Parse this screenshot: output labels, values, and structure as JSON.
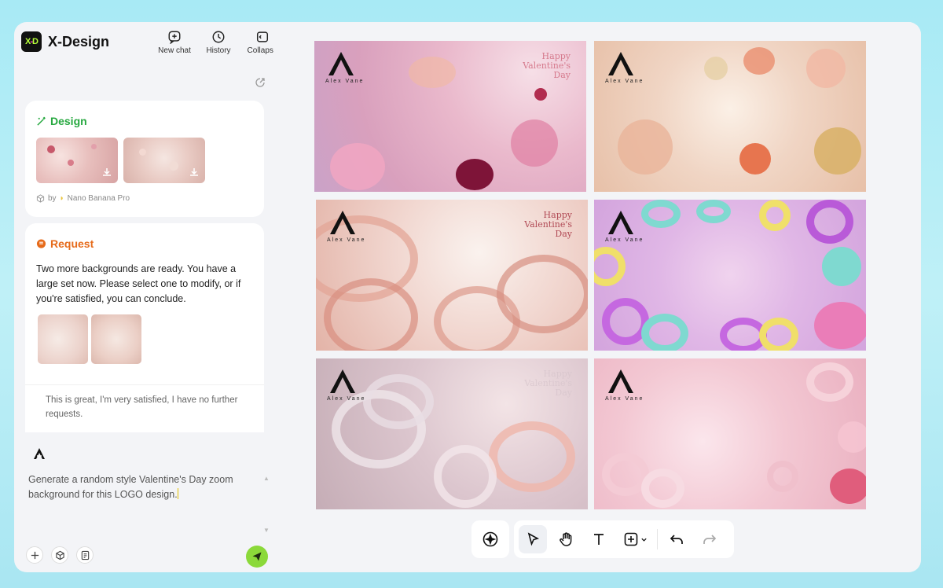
{
  "app": {
    "name": "X-Design",
    "logo_text": "X-D"
  },
  "top_actions": [
    {
      "label": "New chat",
      "icon": "new-chat-icon"
    },
    {
      "label": "History",
      "icon": "clock-icon"
    },
    {
      "label": "Collapse",
      "icon": "collapse-icon"
    }
  ],
  "design_card": {
    "title": "Design",
    "byline_prefix": "by",
    "byline_model": "Nano Banana Pro"
  },
  "request_card": {
    "title": "Request",
    "message": "Two more backgrounds are ready. You have a large set now. Please select one to modify, or if you're satisfied, you can conclude.",
    "reply": "This is great, I'm very satisfied, I have no further requests."
  },
  "prompt": {
    "text": "Generate a random style Valentine's Day zoom background for this LOGO design."
  },
  "gallery": {
    "brand": "Alex Vane",
    "valentine_lines": [
      "Happy",
      "Valentine's",
      "Day"
    ],
    "faded_lines": [
      "Happy",
      "Valentine's",
      "Day"
    ]
  },
  "colors": {
    "accent_green": "#27a840",
    "accent_orange": "#e66b1b",
    "send_button": "#8bd93a"
  }
}
